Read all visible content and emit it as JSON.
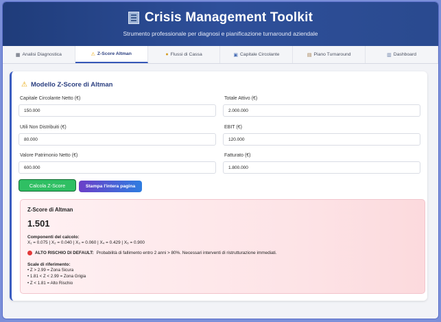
{
  "header": {
    "title": "Crisis Management Toolkit",
    "subtitle": "Strumento professionale per diagnosi e pianificazione turnaround aziendale"
  },
  "tabs": [
    {
      "label": "Analisi Diagnostica",
      "icon": "chart-icon"
    },
    {
      "label": "Z-Score Altman",
      "icon": "warning-icon"
    },
    {
      "label": "Flussi di Cassa",
      "icon": "money-icon"
    },
    {
      "label": "Capitale Circolante",
      "icon": "calc-icon"
    },
    {
      "label": "Piano Turnaround",
      "icon": "clipboard-icon"
    },
    {
      "label": "Dashboard",
      "icon": "dashboard-icon"
    }
  ],
  "card": {
    "title": "Modello Z-Score di Altman",
    "fields": [
      {
        "label": "Capitale Circolante Netto (€)",
        "value": "150.000"
      },
      {
        "label": "Totale Attivo (€)",
        "value": "2.000.000"
      },
      {
        "label": "Utili Non Distribuiti (€)",
        "value": "80.000"
      },
      {
        "label": "EBIT (€)",
        "value": "120.000"
      },
      {
        "label": "Valore Patrimonio Netto (€)",
        "value": "600.000"
      },
      {
        "label": "Fatturato (€)",
        "value": "1.800.000"
      }
    ],
    "calc_button": "Calcola Z-Score",
    "print_button": "Stampa l'intera pagina"
  },
  "result": {
    "title": "Z-Score di Altman",
    "score": "1.501",
    "components_title": "Componenti del calcolo:",
    "components": "X₁ = 0.075 | X₂ = 0.040 | X₃ = 0.060 | X₄ = 0.429 | X₅ = 0.900",
    "risk_label": "ALTO RISCHIO DI DEFAULT:",
    "risk_text": "Probabilità di fallimento entro 2 anni > 80%. Necessari interventi di ristrutturazione immediati.",
    "scale_title": "Scale di riferimento:",
    "scale": [
      "• Z > 2.99 = Zona Sicura",
      "• 1.81 < Z < 2.99 = Zona Grigia",
      "• Z < 1.81 = Alto Rischio"
    ]
  }
}
